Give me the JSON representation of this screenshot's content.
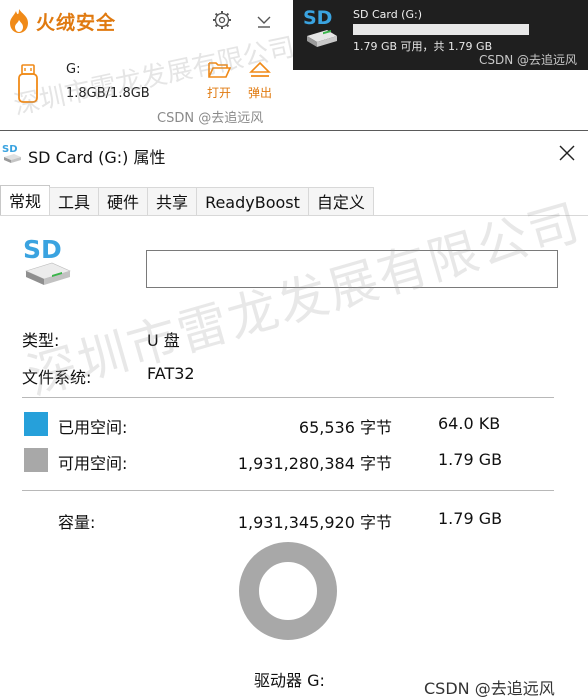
{
  "security_panel": {
    "title": "火绒安全",
    "drive_letter": "G:",
    "usage": "1.8GB/1.8GB",
    "open_label": "打开",
    "eject_label": "弹出",
    "csdn_label": "CSDN @去追远风",
    "accent_color": "#e07a10"
  },
  "toast": {
    "title": "SD Card (G:)",
    "detail": "1.79 GB 可用，共 1.79 GB",
    "csdn_label": "CSDN @去追远风"
  },
  "window": {
    "title": "SD Card (G:) 属性",
    "tabs": [
      "常规",
      "工具",
      "硬件",
      "共享",
      "ReadyBoost",
      "自定义"
    ],
    "active_tab": "常规",
    "name_value": "",
    "type_label": "类型:",
    "type_value": "U 盘",
    "fs_label": "文件系统:",
    "fs_value": "FAT32",
    "used": {
      "label": "已用空间:",
      "bytes": "65,536 字节",
      "size": "64.0 KB",
      "color": "#26a0da"
    },
    "free": {
      "label": "可用空间:",
      "bytes": "1,931,280,384 字节",
      "size": "1.79 GB",
      "color": "#a8a8a8"
    },
    "capacity": {
      "label": "容量:",
      "bytes": "1,931,345,920 字节",
      "size": "1.79 GB"
    },
    "drive_label": "驱动器 G:"
  },
  "watermark": {
    "text": "深圳市雷龙发展有限公司"
  },
  "footer_csdn": "CSDN @去追远风"
}
